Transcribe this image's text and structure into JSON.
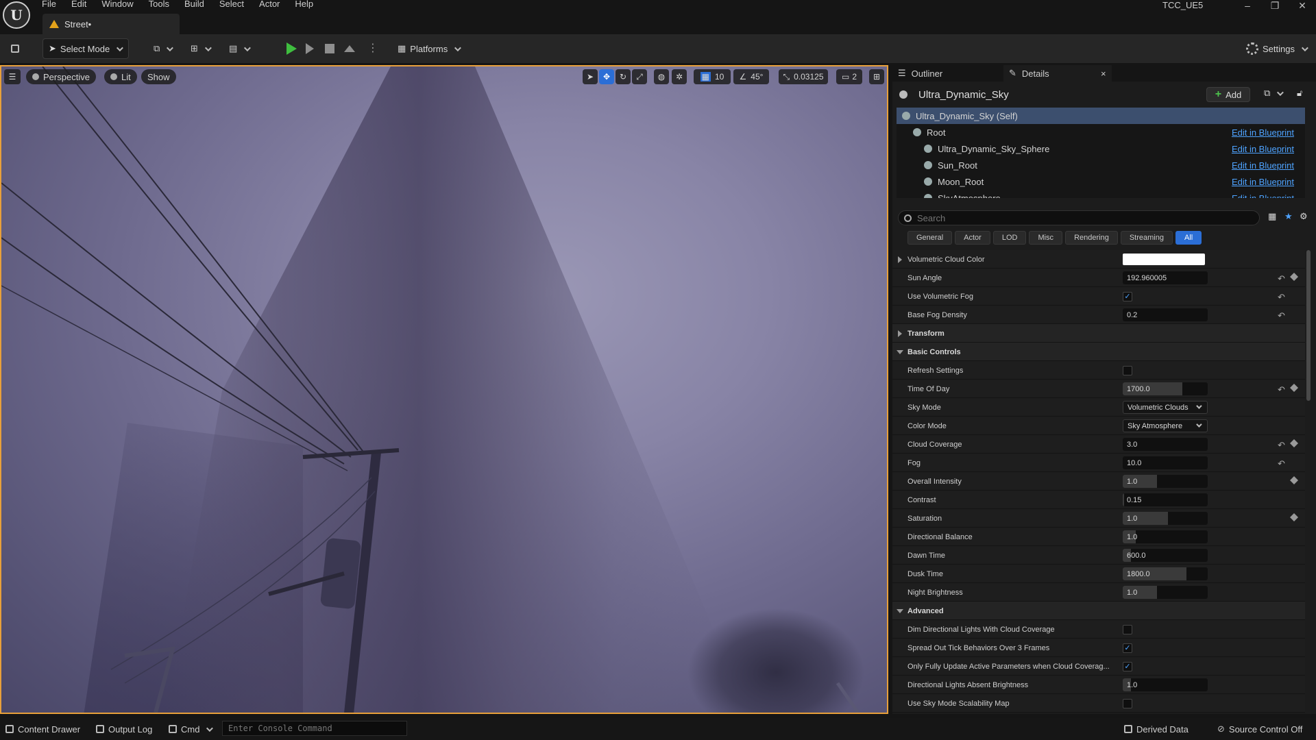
{
  "app": {
    "project_name": "TCC_UE5",
    "level_tab": "Street•",
    "menu": [
      "File",
      "Edit",
      "Window",
      "Tools",
      "Build",
      "Select",
      "Actor",
      "Help"
    ],
    "window_controls": {
      "minimize": "–",
      "restore": "❐",
      "close": "✕"
    },
    "logo": "U"
  },
  "toolbar": {
    "select_mode": "Select Mode",
    "platforms": "Platforms",
    "settings": "Settings"
  },
  "viewport": {
    "perspective": "Perspective",
    "lit": "Lit",
    "show": "Show",
    "grid_snap": "10",
    "rotation_snap": "45°",
    "scale_snap": "0.03125",
    "camera_speed": "2"
  },
  "panel": {
    "outliner_tab": "Outliner",
    "details_tab": "Details",
    "close_glyph": "×",
    "actor_name": "Ultra_Dynamic_Sky",
    "add_label": "Add",
    "components": [
      {
        "name": "Ultra_Dynamic_Sky (Self)",
        "indent": 0,
        "selected": true,
        "link": ""
      },
      {
        "name": "Root",
        "indent": 1,
        "selected": false,
        "link": "Edit in Blueprint"
      },
      {
        "name": "Ultra_Dynamic_Sky_Sphere",
        "indent": 2,
        "selected": false,
        "link": "Edit in Blueprint"
      },
      {
        "name": "Sun_Root",
        "indent": 2,
        "selected": false,
        "link": "Edit in Blueprint"
      },
      {
        "name": "Moon_Root",
        "indent": 2,
        "selected": false,
        "link": "Edit in Blueprint"
      },
      {
        "name": "SkyAtmosphere",
        "indent": 2,
        "selected": false,
        "link": "Edit in Blueprint"
      }
    ],
    "search_placeholder": "Search",
    "filter_tabs": [
      {
        "label": "General",
        "active": false
      },
      {
        "label": "Actor",
        "active": false
      },
      {
        "label": "LOD",
        "active": false
      },
      {
        "label": "Misc",
        "active": false
      },
      {
        "label": "Rendering",
        "active": false
      },
      {
        "label": "Streaming",
        "active": false
      },
      {
        "label": "All",
        "active": true
      }
    ],
    "properties": [
      {
        "label": "Volumetric Cloud Color",
        "kind": "color",
        "expander": "right"
      },
      {
        "label": "Sun Angle",
        "kind": "number",
        "value": "192.960005",
        "fill": 0.0,
        "reset": true,
        "key": true
      },
      {
        "label": "Use Volumetric Fog",
        "kind": "check",
        "checked": true,
        "reset": true
      },
      {
        "label": "Base Fog Density",
        "kind": "number",
        "value": "0.2",
        "fill": 0.0,
        "reset": true
      },
      {
        "label": "Transform",
        "kind": "category",
        "expander": "right"
      },
      {
        "label": "Basic Controls",
        "kind": "category",
        "expander": "down"
      },
      {
        "label": "Refresh Settings",
        "kind": "check",
        "checked": false
      },
      {
        "label": "Time Of Day",
        "kind": "number",
        "value": "1700.0",
        "fill": 0.7,
        "reset": true,
        "key": true
      },
      {
        "label": "Sky Mode",
        "kind": "combo",
        "value": "Volumetric Clouds"
      },
      {
        "label": "Color Mode",
        "kind": "combo",
        "value": "Sky Atmosphere"
      },
      {
        "label": "Cloud Coverage",
        "kind": "number",
        "value": "3.0",
        "fill": 0.0,
        "reset": true,
        "key": true
      },
      {
        "label": "Fog",
        "kind": "number",
        "value": "10.0",
        "fill": 0.0,
        "reset": true
      },
      {
        "label": "Overall Intensity",
        "kind": "number",
        "value": "1.0",
        "fill": 0.4,
        "key": true
      },
      {
        "label": "Contrast",
        "kind": "number",
        "value": "0.15",
        "fill": 0.02
      },
      {
        "label": "Saturation",
        "kind": "number",
        "value": "1.0",
        "fill": 0.53,
        "key": true
      },
      {
        "label": "Directional Balance",
        "kind": "number",
        "value": "1.0",
        "fill": 0.15
      },
      {
        "label": "Dawn Time",
        "kind": "number",
        "value": "600.0",
        "fill": 0.1
      },
      {
        "label": "Dusk Time",
        "kind": "number",
        "value": "1800.0",
        "fill": 0.75
      },
      {
        "label": "Night Brightness",
        "kind": "number",
        "value": "1.0",
        "fill": 0.4
      },
      {
        "label": "Advanced",
        "kind": "category",
        "expander": "down"
      },
      {
        "label": "Dim Directional Lights With Cloud Coverage",
        "kind": "check",
        "checked": false
      },
      {
        "label": "Spread Out Tick Behaviors Over 3 Frames",
        "kind": "check",
        "checked": true
      },
      {
        "label": "Only Fully Update Active Parameters when Cloud Coverag...",
        "kind": "check",
        "checked": true
      },
      {
        "label": "Directional Lights Absent Brightness",
        "kind": "number",
        "value": "1.0",
        "fill": 0.1
      },
      {
        "label": "Use Sky Mode Scalability Map",
        "kind": "check",
        "checked": false
      }
    ]
  },
  "statusbar": {
    "content_drawer": "Content Drawer",
    "output_log": "Output Log",
    "cmd": "Cmd",
    "console_placeholder": "Enter Console Command",
    "derived_data": "Derived Data",
    "source_control": "Source Control Off"
  }
}
